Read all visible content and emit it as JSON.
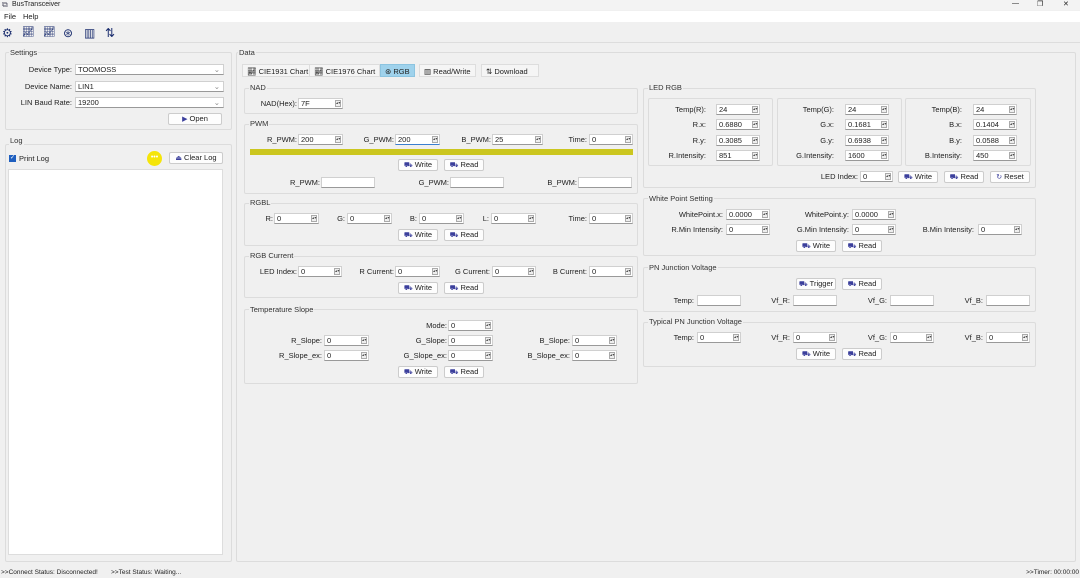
{
  "window": {
    "title": "BusTransceiver",
    "minimize": "—",
    "maximize": "❐",
    "close": "✕"
  },
  "menu": [
    "File",
    "Help"
  ],
  "toolbar": {
    "icons": [
      "gear-icon",
      "chart-line-icon",
      "chart-line-icon",
      "rgb-circles-icon",
      "read-write-icon",
      "transfer-icon"
    ]
  },
  "settings": {
    "title": "Settings",
    "device_type_label": "Device Type:",
    "device_type": "TOOMOSS",
    "device_name_label": "Device Name:",
    "device_name": "LIN1",
    "baud_label": "LIN Baud Rate:",
    "baud": "19200",
    "open": "Open"
  },
  "log": {
    "title": "Log",
    "print_log": "Print Log",
    "print_log_checked": true,
    "clear": "Clear Log",
    "indicator_color": "#f5e50a"
  },
  "data": {
    "title": "Data",
    "tabs": [
      "CIE1931 Chart",
      "CIE1976 Chart",
      "RGB",
      "Read/Write",
      "Download"
    ],
    "active_tab": "RGB"
  },
  "common": {
    "write": "Write",
    "read": "Read",
    "reset": "Reset",
    "trigger": "Trigger"
  },
  "nad": {
    "title": "NAD",
    "label": "NAD(Hex):",
    "value": "7F"
  },
  "pwm": {
    "title": "PWM",
    "r_label": "R_PWM:",
    "r": "200",
    "g_label": "G_PWM:",
    "g": "200",
    "b_label": "B_PWM:",
    "b": "25",
    "time_label": "Time:",
    "time": "0",
    "color_bar": "#cbc61f",
    "rr_label": "R_PWM:",
    "rg_label": "G_PWM:",
    "rb_label": "B_PWM:"
  },
  "rgbl": {
    "title": "RGBL",
    "r_label": "R:",
    "r": "0",
    "g_label": "G:",
    "g": "0",
    "b_label": "B:",
    "b": "0",
    "l_label": "L:",
    "l": "0",
    "time_label": "Time:",
    "time": "0"
  },
  "current": {
    "title": "RGB Current",
    "idx_label": "LED Index:",
    "idx": "0",
    "r_label": "R Current:",
    "r": "0",
    "g_label": "G Current:",
    "g": "0",
    "b_label": "B Current:",
    "b": "0"
  },
  "slope": {
    "title": "Temperature Slope",
    "mode_label": "Mode:",
    "mode": "0",
    "r_label": "R_Slope:",
    "r": "0",
    "g_label": "G_Slope:",
    "g": "0",
    "b_label": "B_Slope:",
    "b": "0",
    "rex_label": "R_Slope_ex:",
    "rex": "0",
    "gex_label": "G_Slope_ex:",
    "gex": "0",
    "bex_label": "B_Slope_ex:",
    "bex": "0"
  },
  "led": {
    "title": "LED RGB",
    "r": {
      "temp_label": "Temp(R):",
      "temp": "24",
      "x_label": "R.x:",
      "x": "0.6880",
      "y_label": "R.y:",
      "y": "0.3085",
      "i_label": "R.Intensity:",
      "i": "851"
    },
    "g": {
      "temp_label": "Temp(G):",
      "temp": "24",
      "x_label": "G.x:",
      "x": "0.1681",
      "y_label": "G.y:",
      "y": "0.6938",
      "i_label": "G.Intensity:",
      "i": "1600"
    },
    "b": {
      "temp_label": "Temp(B):",
      "temp": "24",
      "x_label": "B.x:",
      "x": "0.1404",
      "y_label": "B.y:",
      "y": "0.0588",
      "i_label": "B.Intensity:",
      "i": "450"
    },
    "idx_label": "LED Index:",
    "idx": "0"
  },
  "white": {
    "title": "White Point Setting",
    "wx_label": "WhitePoint.x:",
    "wx": "0.0000",
    "wy_label": "WhitePoint.y:",
    "wy": "0.0000",
    "r_label": "R.Min Intensity:",
    "r": "0",
    "g_label": "G.Min Intensity:",
    "g": "0",
    "b_label": "B.Min Intensity:",
    "b": "0"
  },
  "pn": {
    "title": "PN Junction Voltage",
    "temp_label": "Temp:",
    "vr_label": "Vf_R:",
    "vg_label": "Vf_G:",
    "vb_label": "Vf_B:"
  },
  "typ": {
    "title": "Typical PN Junction Voltage",
    "temp_label": "Temp:",
    "temp": "0",
    "vr_label": "Vf_R:",
    "vr": "0",
    "vg_label": "Vf_G:",
    "vg": "0",
    "vb_label": "Vf_B:",
    "vb": "0"
  },
  "status": {
    "connect": ">>Connect Status: Disconnected!",
    "test": ">>Test Status: Waiting...",
    "timer": ">>Timer: 00:00:00"
  }
}
